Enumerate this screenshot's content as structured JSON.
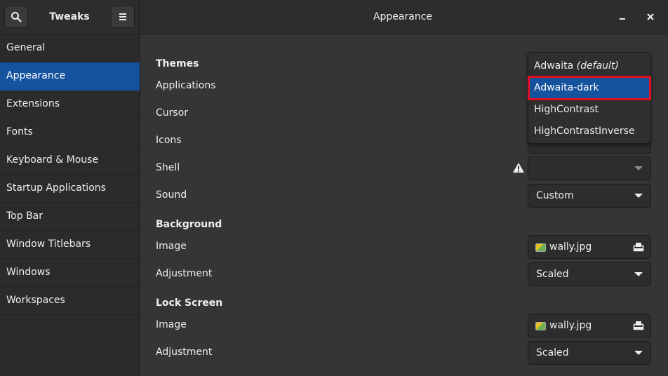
{
  "header": {
    "app_title": "Tweaks",
    "page_title": "Appearance"
  },
  "sidebar": {
    "items": [
      {
        "label": "General"
      },
      {
        "label": "Appearance"
      },
      {
        "label": "Extensions"
      },
      {
        "label": "Fonts"
      },
      {
        "label": "Keyboard & Mouse"
      },
      {
        "label": "Startup Applications"
      },
      {
        "label": "Top Bar"
      },
      {
        "label": "Window Titlebars"
      },
      {
        "label": "Windows"
      },
      {
        "label": "Workspaces"
      }
    ],
    "selected": "Appearance"
  },
  "themes": {
    "heading": "Themes",
    "applications_label": "Applications",
    "cursor_label": "Cursor",
    "icons_label": "Icons",
    "shell_label": "Shell",
    "shell_value": "",
    "sound_label": "Sound",
    "sound_value": "Custom"
  },
  "background": {
    "heading": "Background",
    "image_label": "Image",
    "image_value": "wally.jpg",
    "adjustment_label": "Adjustment",
    "adjustment_value": "Scaled"
  },
  "lock_screen": {
    "heading": "Lock Screen",
    "image_label": "Image",
    "image_value": "wally.jpg",
    "adjustment_label": "Adjustment",
    "adjustment_value": "Scaled"
  },
  "popup": {
    "options": [
      {
        "name": "Adwaita",
        "suffix": "(default)"
      },
      {
        "name": "Adwaita-dark",
        "suffix": ""
      },
      {
        "name": "HighContrast",
        "suffix": ""
      },
      {
        "name": "HighContrastInverse",
        "suffix": ""
      }
    ],
    "selected": "Adwaita-dark"
  },
  "colors": {
    "accent": "#15539e",
    "highlight_box": "#e0101e"
  },
  "icons": {
    "search": "search-icon",
    "menu": "hamburger-menu-icon",
    "minimize": "minimize-icon",
    "close": "close-icon",
    "warning": "warning-icon",
    "file_open": "document-open-icon",
    "image_file": "image-file-icon"
  }
}
